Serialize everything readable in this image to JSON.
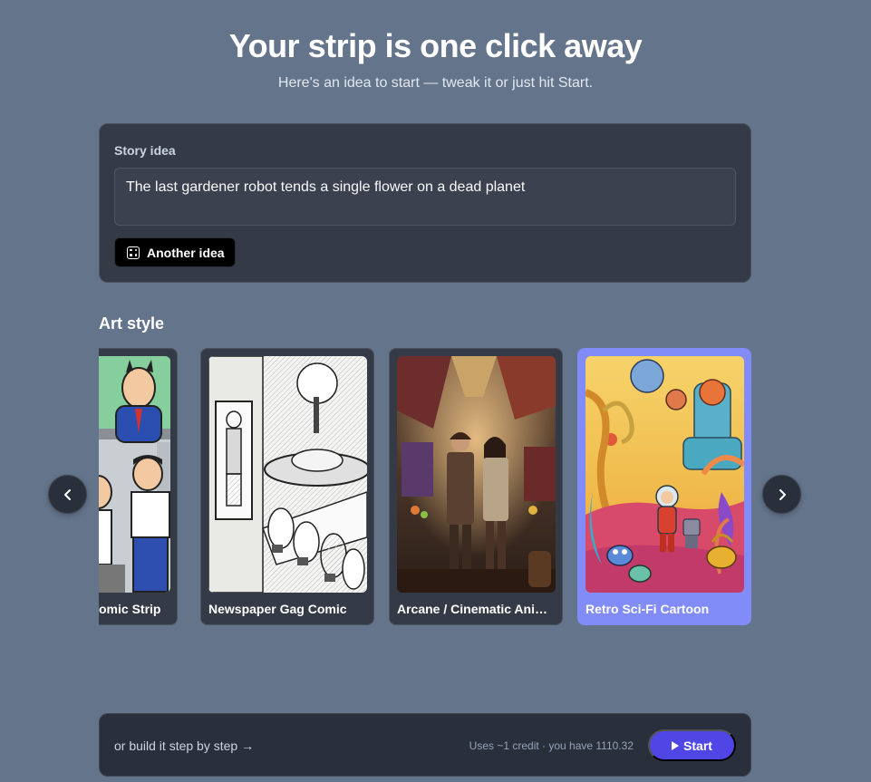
{
  "header": {
    "title": "Your strip is one click away",
    "subtitle": "Here's an idea to start — tweak it or just hit Start."
  },
  "story": {
    "label": "Story idea",
    "value": "The last gardener robot tends a single flower on a dead planet",
    "another_idea_label": "Another idea",
    "another_idea_icon": "dice-icon"
  },
  "art_style": {
    "label": "Art style",
    "cards": [
      {
        "name": "Office Comic Strip",
        "visible_name": "omic Strip",
        "selected": false
      },
      {
        "name": "Newspaper Gag Comic",
        "selected": false
      },
      {
        "name": "Arcane / Cinematic Anim...",
        "selected": false
      },
      {
        "name": "Retro Sci-Fi Cartoon",
        "selected": true
      }
    ],
    "prev_icon": "chevron-left-icon",
    "next_icon": "chevron-right-icon"
  },
  "footer": {
    "step_link": "or build it step by step →",
    "credits": "Uses ~1 credit · you have 1110.32",
    "start_label": "Start",
    "start_icon": "play-icon"
  },
  "colors": {
    "background": "#64748b",
    "card": "#343a46",
    "selected": "#818cf8",
    "accent": "#4f46e5"
  }
}
